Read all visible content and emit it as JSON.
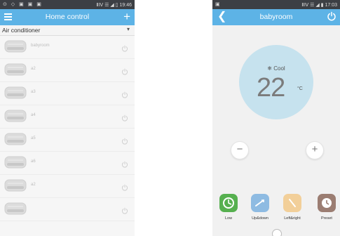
{
  "left_screen": {
    "status": {
      "icons": "⊙ ◇ ▣ ▣ ▣",
      "right": "ⅡⅣ ☰ ◢ ▯ 19:46"
    },
    "header": {
      "title": "Home control"
    },
    "section": {
      "label": "Air conditioner"
    },
    "devices": [
      {
        "label": "babyroom"
      },
      {
        "label": "a2"
      },
      {
        "label": "a3"
      },
      {
        "label": "a4"
      },
      {
        "label": "a5"
      },
      {
        "label": "a6"
      },
      {
        "label": "a2"
      },
      {
        "label": ""
      }
    ]
  },
  "right_screen": {
    "status": {
      "right": "ⅡⅣ ☰ ◢ ▮ 17:03"
    },
    "header": {
      "title": "babyroom"
    },
    "mode": {
      "label": "❄ Cool"
    },
    "temperature": {
      "value": "22",
      "unit": "°C"
    },
    "buttons": {
      "minus": "−",
      "plus": "+"
    },
    "functions": [
      {
        "label": "Low",
        "color": "#56b04f"
      },
      {
        "label": "Up&down",
        "color": "#8ebbe2"
      },
      {
        "label": "Left&right",
        "color": "#f2cf99"
      },
      {
        "label": "Preset",
        "color": "#9b7d72"
      }
    ]
  },
  "colors": {
    "accent": "#5db3e6",
    "dial": "#c6e2ee"
  }
}
